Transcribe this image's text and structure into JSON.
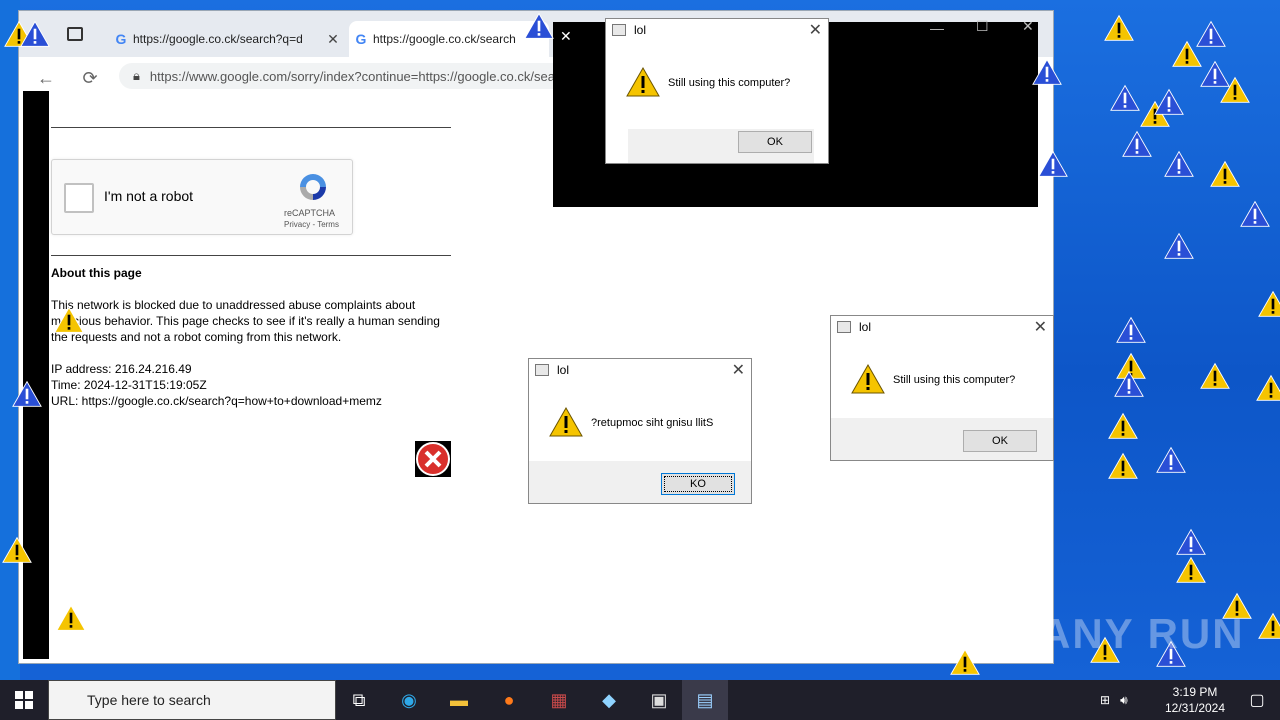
{
  "browser": {
    "tabs": [
      {
        "label": "https://google.co.ck/search?q=d"
      },
      {
        "label": "https://google.co.ck/search"
      }
    ],
    "url": "https://www.google.com/sorry/index?continue=https://google.co.ck/search"
  },
  "captcha": {
    "label": "I'm not a robot",
    "brand": "reCAPTCHA",
    "links": "Privacy - Terms"
  },
  "page": {
    "heading": "About this page",
    "para1": "This network is blocked due to unaddressed abuse complaints about malicious behavior. This page checks to see if it's really a human sending the requests and not a robot coming from this network.",
    "ip": "IP address: 216.24.216.49",
    "time": "Time: 2024-12-31T15:19:05Z",
    "url": "URL: https://google.co.ck/search?q=how+to+download+memz"
  },
  "dialogs": [
    {
      "title": "lol",
      "message": "Still using this computer?",
      "button": "OK"
    },
    {
      "title": "lol",
      "message": "?retupmoc siht gnisu llitS",
      "button": "KO"
    },
    {
      "title": "lol",
      "message": "Still using this computer?",
      "button": "OK"
    }
  ],
  "taskbar": {
    "search_placeholder": "Type here to search",
    "time": "3:19 PM",
    "date": "12/31/2024"
  },
  "watermark": "ANY RUN"
}
